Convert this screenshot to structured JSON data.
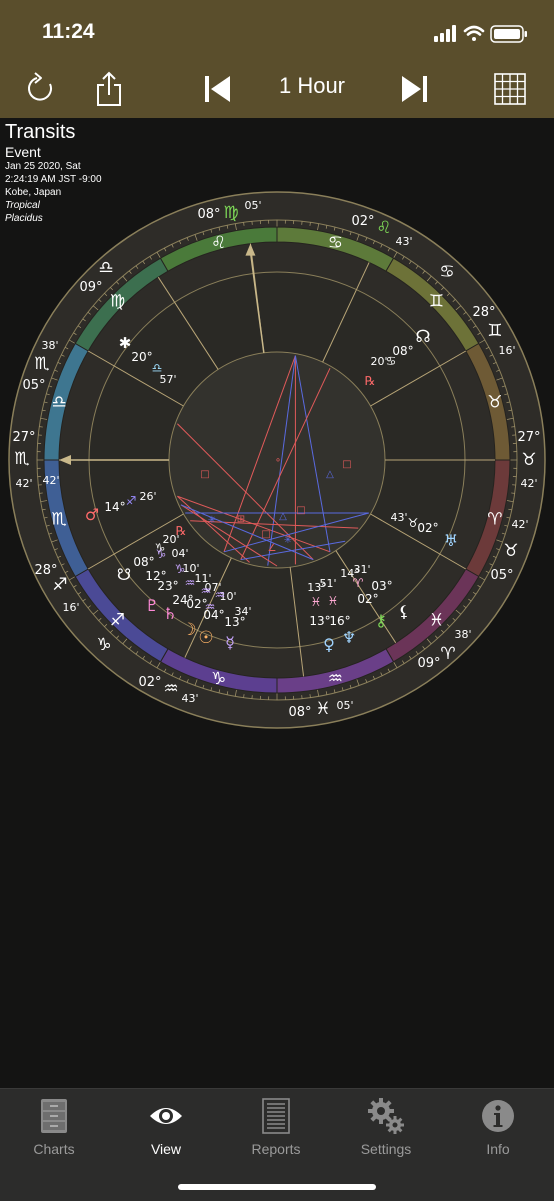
{
  "status": {
    "time": "11:24"
  },
  "toolbar": {
    "refresh_icon": "refresh-icon",
    "share_icon": "share-icon",
    "prev_icon": "skip-back-icon",
    "step_label": "1 Hour",
    "next_icon": "skip-forward-icon",
    "grid_icon": "grid-icon"
  },
  "chart_info": {
    "title": "Transits",
    "subtitle": "Event",
    "date": "Jan 25 2020, Sat",
    "time": "2:24:19 AM JST -9:00",
    "location": "Kobe, Japan",
    "zodiac": "Tropical",
    "house_system": "Placidus"
  },
  "wheel": {
    "outer_labels": [
      {
        "text": "08°",
        "color": "#ffffff"
      },
      {
        "text": "♍",
        "color": "#7ed957"
      },
      {
        "text": "05'",
        "color": "#ffffff"
      },
      {
        "text": "02°",
        "color": "#ffffff"
      },
      {
        "text": "♌",
        "color": "#7ed957"
      },
      {
        "text": "43'",
        "color": "#ffffff"
      },
      {
        "text": "♋",
        "color": "#ffffff"
      },
      {
        "text": "28°",
        "color": "#ffffff"
      },
      {
        "text": "♊",
        "color": "#ffffff"
      },
      {
        "text": "16'",
        "color": "#ffffff"
      },
      {
        "text": "27°",
        "color": "#ffffff"
      },
      {
        "text": "♉",
        "color": "#ffffff"
      },
      {
        "text": "42'",
        "color": "#ffffff"
      },
      {
        "text": "42'",
        "color": "#ffffff"
      },
      {
        "text": "♉",
        "color": "#ffffff"
      },
      {
        "text": "05°",
        "color": "#ffffff"
      },
      {
        "text": "38'",
        "color": "#ffffff"
      },
      {
        "text": "♈",
        "color": "#ffffff"
      },
      {
        "text": "09°",
        "color": "#ffffff"
      },
      {
        "text": "08°",
        "color": "#ffffff"
      },
      {
        "text": "♓",
        "color": "#ffffff"
      },
      {
        "text": "05'",
        "color": "#ffffff"
      },
      {
        "text": "02°",
        "color": "#ffffff"
      },
      {
        "text": "♒",
        "color": "#ffffff"
      },
      {
        "text": "43'",
        "color": "#ffffff"
      },
      {
        "text": "♑",
        "color": "#ffffff"
      },
      {
        "text": "16'",
        "color": "#ffffff"
      },
      {
        "text": "28°",
        "color": "#ffffff"
      },
      {
        "text": "♐",
        "color": "#ffffff"
      },
      {
        "text": "42'",
        "color": "#ffffff"
      },
      {
        "text": "27°",
        "color": "#ffffff"
      },
      {
        "text": "♏",
        "color": "#ffffff"
      },
      {
        "text": "42'",
        "color": "#ffffff"
      },
      {
        "text": "05°",
        "color": "#ffffff"
      },
      {
        "text": "♏",
        "color": "#ffffff"
      },
      {
        "text": "38'",
        "color": "#ffffff"
      },
      {
        "text": "♎",
        "color": "#ffffff"
      },
      {
        "text": "09°",
        "color": "#ffffff"
      }
    ],
    "sign_glyphs": [
      "♍",
      "♌",
      "♋",
      "♊",
      "♉",
      "♈",
      "♓",
      "♒",
      "♑",
      "♐",
      "♏",
      "♎"
    ],
    "sign_colors": [
      "#3c6f4f",
      "#4a7a3a",
      "#5d7a3a",
      "#6d7238",
      "#6e5a35",
      "#6c3a3a",
      "#6b3458",
      "#6a3f88",
      "#5c3f90",
      "#4b4a96",
      "#3f5f95",
      "#3e7690"
    ],
    "planet_labels": [
      {
        "text": "☊",
        "color": "#ffffff"
      },
      {
        "text": "08°",
        "color": "#ffffff"
      },
      {
        "text": "♋",
        "color": "#ffffff"
      },
      {
        "text": "20'",
        "color": "#ffffff"
      },
      {
        "text": "℞",
        "color": "#ff6a6a"
      },
      {
        "text": "✱",
        "color": "#ffffff"
      },
      {
        "text": "20°",
        "color": "#ffffff"
      },
      {
        "text": "♎",
        "color": "#a0e0ff"
      },
      {
        "text": "57'",
        "color": "#ffffff"
      },
      {
        "text": "♂",
        "color": "#ff6a6a"
      },
      {
        "text": "14°",
        "color": "#ffffff"
      },
      {
        "text": "♐",
        "color": "#9a8cff"
      },
      {
        "text": "26'",
        "color": "#ffffff"
      },
      {
        "text": "43'",
        "color": "#ffffff"
      },
      {
        "text": "♉",
        "color": "#ffffff"
      },
      {
        "text": "02°",
        "color": "#ffffff"
      },
      {
        "text": "♅",
        "color": "#a0d4ff"
      },
      {
        "text": "☋",
        "color": "#ffffff"
      },
      {
        "text": "08°",
        "color": "#ffffff"
      },
      {
        "text": "♑",
        "color": "#ffffff"
      },
      {
        "text": "20'",
        "color": "#ffffff"
      },
      {
        "text": "℞",
        "color": "#ff6a6a"
      },
      {
        "text": "04'",
        "color": "#ffffff"
      },
      {
        "text": "10'",
        "color": "#ffffff"
      },
      {
        "text": "11'",
        "color": "#ffffff"
      },
      {
        "text": "07'",
        "color": "#ffffff"
      },
      {
        "text": "12°",
        "color": "#ffffff"
      },
      {
        "text": "♑",
        "color": "#c8a6ff"
      },
      {
        "text": "♑",
        "color": "#c8a6ff"
      },
      {
        "text": "10'",
        "color": "#ffffff"
      },
      {
        "text": "34'",
        "color": "#ffffff"
      },
      {
        "text": "23°",
        "color": "#ffffff"
      },
      {
        "text": "♒",
        "color": "#c8a6ff"
      },
      {
        "text": "24°",
        "color": "#ffffff"
      },
      {
        "text": "♒",
        "color": "#c8a6ff"
      },
      {
        "text": "02°",
        "color": "#ffffff"
      },
      {
        "text": "♒",
        "color": "#c8a6ff"
      },
      {
        "text": "♒",
        "color": "#c8a6ff"
      },
      {
        "text": "04°",
        "color": "#ffffff"
      },
      {
        "text": "13°",
        "color": "#ffffff"
      },
      {
        "text": "♇",
        "color": "#ff8ad8"
      },
      {
        "text": "♄",
        "color": "#ff8ad8"
      },
      {
        "text": "☽",
        "color": "#ffb366"
      },
      {
        "text": "☉",
        "color": "#ffb366"
      },
      {
        "text": "☿",
        "color": "#c8a6ff"
      },
      {
        "text": "13°",
        "color": "#ffffff"
      },
      {
        "text": "51'",
        "color": "#ffffff"
      },
      {
        "text": "14°",
        "color": "#ffffff"
      },
      {
        "text": "31'",
        "color": "#ffffff"
      },
      {
        "text": "♈",
        "color": "#ffaad4"
      },
      {
        "text": "♓",
        "color": "#ffaad4"
      },
      {
        "text": "♓",
        "color": "#ffaad4"
      },
      {
        "text": "03°",
        "color": "#ffffff"
      },
      {
        "text": "02°",
        "color": "#ffffff"
      },
      {
        "text": "13°",
        "color": "#ffffff"
      },
      {
        "text": "16°",
        "color": "#ffffff"
      },
      {
        "text": "♀",
        "color": "#a0d4ff"
      },
      {
        "text": "♆",
        "color": "#a0d4ff"
      },
      {
        "text": "⚷",
        "color": "#7ed957"
      },
      {
        "text": "⚸",
        "color": "#ffffff"
      }
    ],
    "colors": {
      "ring_bg": "#2e2c28",
      "ring_border": "#8a7f5a",
      "house_line": "#b8a577",
      "aspect_red": "#e05a5a",
      "aspect_blue": "#5a6ae0"
    }
  },
  "tabs": [
    {
      "label": "Charts",
      "icon": "cabinet-icon"
    },
    {
      "label": "View",
      "icon": "eye-icon"
    },
    {
      "label": "Reports",
      "icon": "document-icon"
    },
    {
      "label": "Settings",
      "icon": "gears-icon"
    },
    {
      "label": "Info",
      "icon": "info-icon"
    }
  ]
}
